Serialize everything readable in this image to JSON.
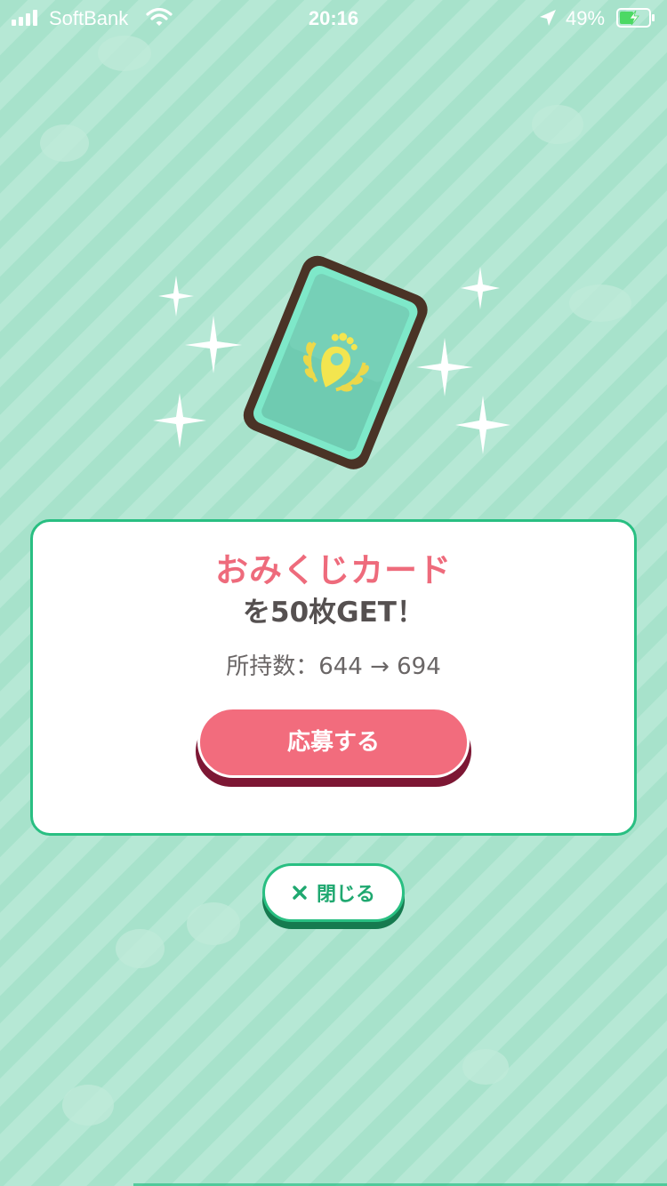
{
  "status_bar": {
    "carrier": "SoftBank",
    "time": "20:16",
    "battery_percent": "49%",
    "battery_level": 0.49,
    "icons": [
      "signal-icon",
      "wifi-icon",
      "location-arrow-icon",
      "battery-charging-icon"
    ]
  },
  "reward": {
    "card_icon": "omikuji-card-icon",
    "item_name": "おみくじカード",
    "get_text": "を50枚GET！",
    "count_line": "所持数：644 → 694"
  },
  "buttons": {
    "apply_label": "応募する",
    "close_label": "閉じる"
  },
  "colors": {
    "background": "#a7e2cb",
    "accent_green": "#29bf82",
    "accent_pink": "#f26c7d",
    "item_name_pink": "#ee6b7c"
  }
}
